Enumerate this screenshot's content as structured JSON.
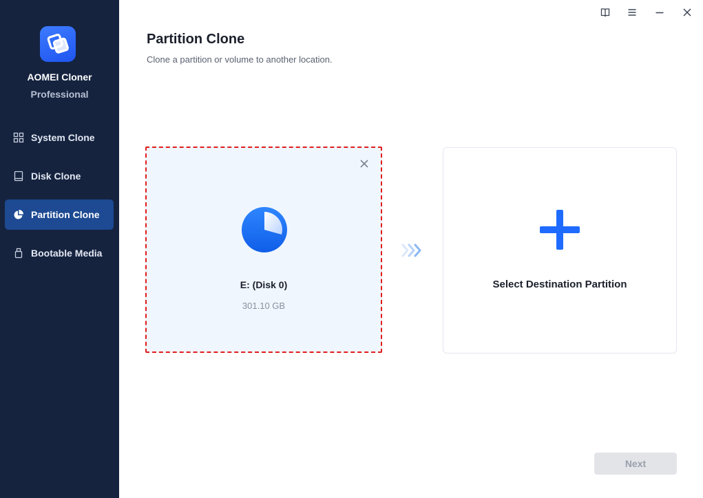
{
  "brand": {
    "name": "AOMEI Cloner",
    "edition": "Professional"
  },
  "sidebar": {
    "items": [
      {
        "label": "System Clone",
        "icon": "grid-icon",
        "active": false
      },
      {
        "label": "Disk Clone",
        "icon": "disk-icon",
        "active": false
      },
      {
        "label": "Partition Clone",
        "icon": "pie-chart-icon",
        "active": true
      },
      {
        "label": "Bootable Media",
        "icon": "usb-drive-icon",
        "active": false
      }
    ]
  },
  "window_controls": [
    "help-book-icon",
    "menu-icon",
    "minimize-icon",
    "close-icon"
  ],
  "header": {
    "title": "Partition Clone",
    "subtitle": "Clone a partition or volume to another location."
  },
  "source": {
    "name": "E: (Disk 0)",
    "size": "301.10 GB"
  },
  "destination": {
    "label": "Select Destination Partition"
  },
  "footer": {
    "next_label": "Next"
  },
  "colors": {
    "sidebar_bg": "#15233f",
    "active_item": "#1d4a92",
    "accent": "#1f6bff",
    "selection_border": "#e01c1c",
    "source_card_bg": "#f0f6fe",
    "disabled_button": "#e2e4e8"
  }
}
